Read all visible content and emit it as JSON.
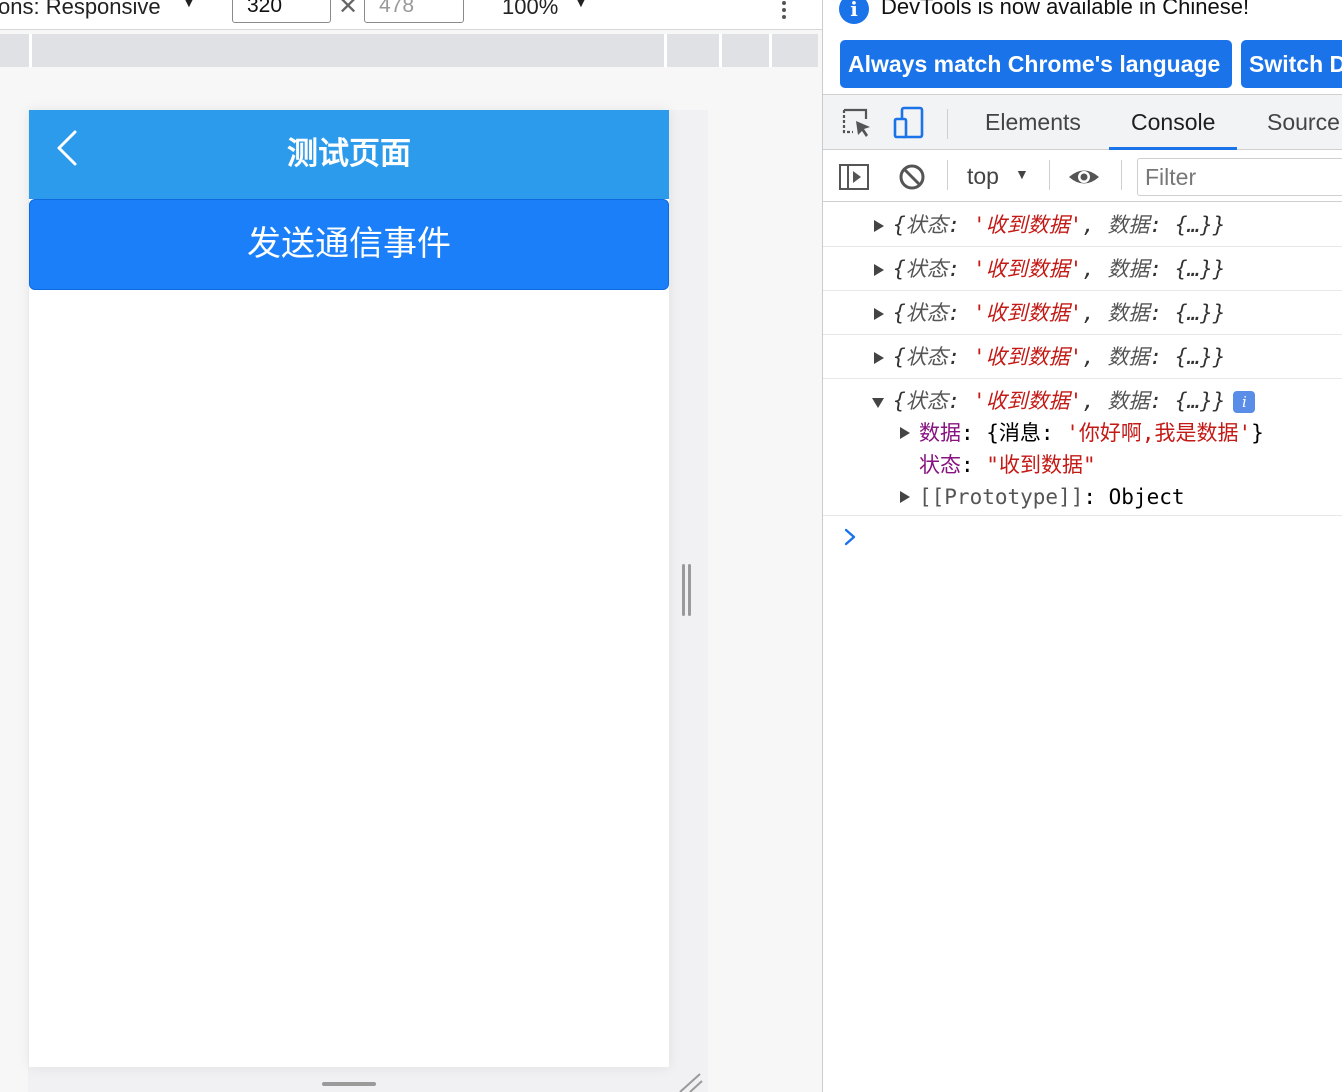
{
  "device_toolbar": {
    "dimensions_label": "ons: Responsive",
    "width_value": "320",
    "height_value": "478",
    "times_symbol": "✕",
    "zoom_label": "100%"
  },
  "app_page": {
    "title": "测试页面",
    "send_button": "发送通信事件"
  },
  "devtools": {
    "infobar": {
      "icon": "i",
      "message": "DevTools is now available in Chinese!",
      "buttons": [
        "Always match Chrome's language",
        "Switch D"
      ]
    },
    "tabs": [
      "Elements",
      "Console",
      "Source"
    ],
    "active_tab": "Console",
    "console_toolbar": {
      "context": "top",
      "filter_placeholder": "Filter"
    },
    "log_rows": [
      {
        "open": "{",
        "k1": "状态",
        "colon": ": ",
        "v1": "'收到数据'",
        "comma": ", ",
        "k2": "数据",
        "v2": "{…}}"
      },
      {
        "open": "{",
        "k1": "状态",
        "colon": ": ",
        "v1": "'收到数据'",
        "comma": ", ",
        "k2": "数据",
        "v2": "{…}}"
      },
      {
        "open": "{",
        "k1": "状态",
        "colon": ": ",
        "v1": "'收到数据'",
        "comma": ", ",
        "k2": "数据",
        "v2": "{…}}"
      },
      {
        "open": "{",
        "k1": "状态",
        "colon": ": ",
        "v1": "'收到数据'",
        "comma": ", ",
        "k2": "数据",
        "v2": "{…}}"
      }
    ],
    "expanded_row": {
      "summary": {
        "open": "{",
        "k1": "状态",
        "colon": ": ",
        "v1": "'收到数据'",
        "comma": ", ",
        "k2": "数据",
        "v2": "{…}}"
      },
      "badge": "i",
      "prop1_key": "数据",
      "prop1_value_open": ": {消息: ",
      "prop1_value_str": "'你好啊,我是数据'",
      "prop1_value_close": "}",
      "prop2_key": "状态",
      "prop2_sep": ": ",
      "prop2_value": "\"收到数据\"",
      "prop3_key": "[[Prototype]]",
      "prop3_value": ": Object"
    }
  }
}
